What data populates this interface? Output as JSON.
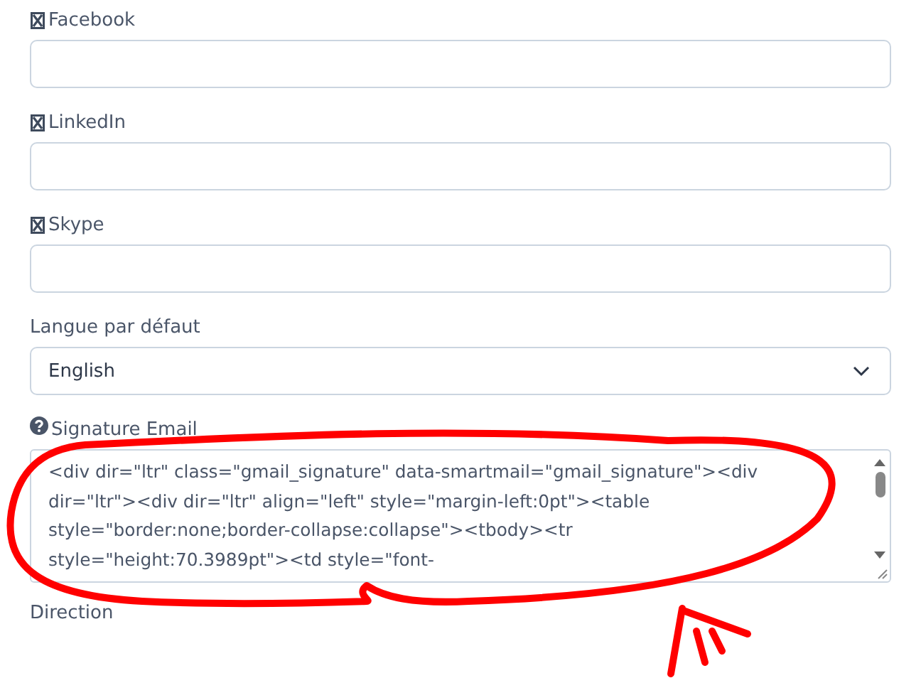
{
  "fields": [
    {
      "kind": "social",
      "label": "Facebook"
    },
    {
      "kind": "social",
      "label": "LinkedIn"
    },
    {
      "kind": "social",
      "label": "Skype"
    },
    {
      "kind": "select",
      "label": "Langue par défaut",
      "value": "English"
    },
    {
      "kind": "textarea",
      "label": "Signature Email",
      "value_lines": [
        "<div dir=\"ltr\" class=\"gmail_signature\" data-smartmail=\"gmail_signature\"><div",
        "dir=\"ltr\"><div dir=\"ltr\" align=\"left\" style=\"margin-left:0pt\"><table",
        "style=\"border:none;border-collapse:collapse\"><tbody><tr",
        "style=\"height:70.3989pt\"><td style=\"font-"
      ]
    },
    {
      "kind": "heading",
      "label": "Direction"
    }
  ],
  "annotation": {
    "kind": "scribble"
  }
}
